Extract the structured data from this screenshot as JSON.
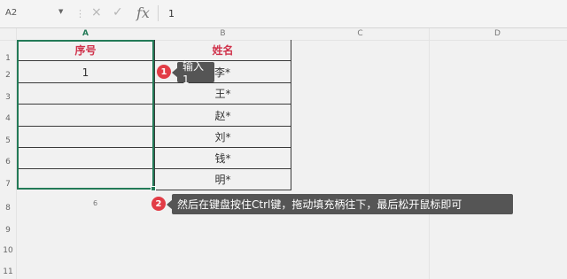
{
  "formula_bar": {
    "cell_ref": "A2",
    "dropdown_icon": "triangle-down-icon",
    "separator": "⋮",
    "cancel_icon": "×",
    "confirm_icon": "✓",
    "fx_label": "fx",
    "value": "1"
  },
  "columns": [
    "A",
    "B",
    "C",
    "D"
  ],
  "rows": [
    "1",
    "2",
    "3",
    "4",
    "5",
    "6",
    "7",
    "8",
    "9",
    "10",
    "11"
  ],
  "table": {
    "headers": [
      "序号",
      "姓名"
    ],
    "col_a": [
      "1",
      "",
      "",
      "",
      "",
      ""
    ],
    "col_b": [
      "李*",
      "王*",
      "赵*",
      "刘*",
      "钱*",
      "明*"
    ]
  },
  "autofill_count": "6",
  "callouts": [
    {
      "badge": "1",
      "text": "输入1"
    },
    {
      "badge": "2",
      "text": "然后在键盘按住Ctrl键，拖动填充柄往下，最后松开鼠标即可"
    }
  ],
  "colors": {
    "selection": "#237a57",
    "header_text": "#d0324b",
    "badge": "#e23c46",
    "tip_bg": "#555555"
  }
}
